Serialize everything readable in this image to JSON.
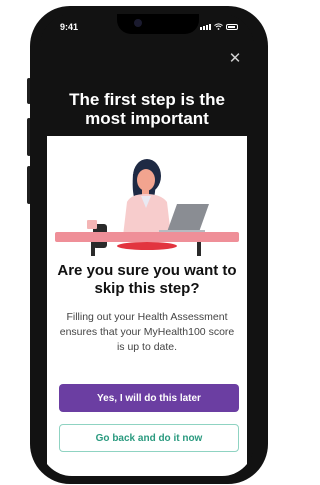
{
  "status_bar": {
    "time": "9:41"
  },
  "header": {
    "headline": "The first step is the most important",
    "close_icon": "close-icon"
  },
  "dialog": {
    "question": "Are you sure you want to skip this step?",
    "body": "Filling out your Health Assessment ensures that your MyHealth100 score is up to date.",
    "primary_label": "Yes, I will do this later",
    "secondary_label": "Go back and do it now"
  },
  "colors": {
    "primary": "#6b3ea2",
    "secondary_text": "#2a9a7f",
    "desk": "#ef8f98",
    "background_dark": "#121212"
  }
}
